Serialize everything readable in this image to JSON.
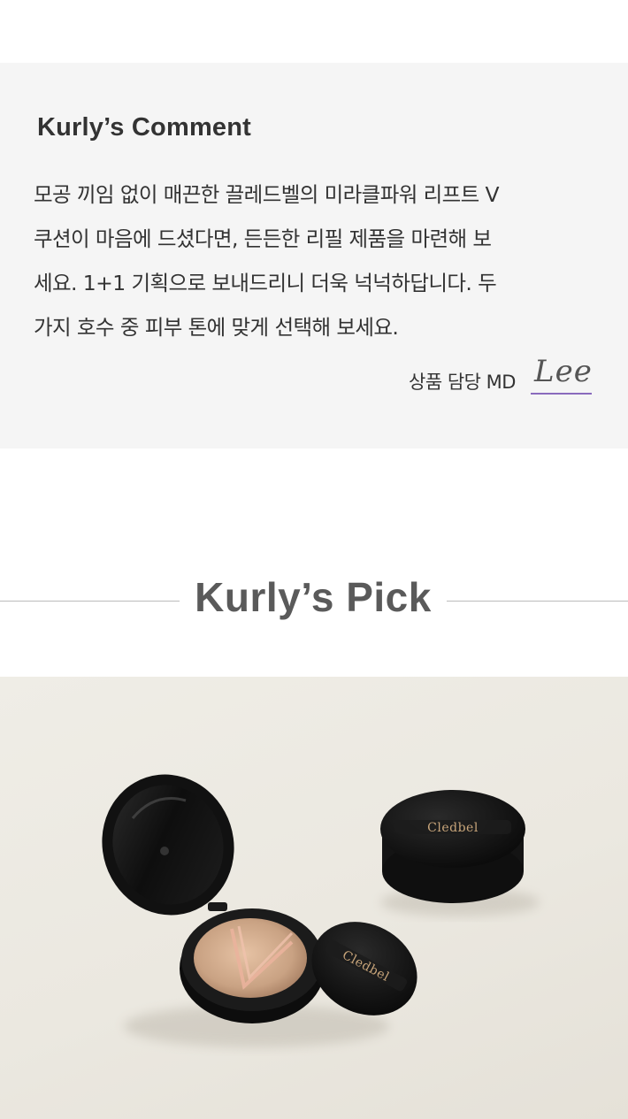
{
  "comment": {
    "title": "Kurly’s Comment",
    "lines": [
      "모공 끼임 없이 매끈한 끌레드벨의 미라클파워 리프트 V",
      "쿠션이 마음에 드셨다면, 든든한 리필 제품을 마련해 보",
      "세요. 1+1 기획으로 보내드리니 더욱 넉넉하답니다. 두",
      "가지 호수 중 피부 톤에 맞게 선택해 보세요."
    ],
    "md_label": "상품 담당 MD",
    "md_signature": "Lee"
  },
  "pick": {
    "title": "Kurly’s Pick"
  },
  "product": {
    "brand_left": "Cledbel",
    "brand_right": "Cledbel"
  },
  "colors": {
    "comment_bg": "#f5f5f5",
    "signature_underline": "#8a6bbd"
  }
}
